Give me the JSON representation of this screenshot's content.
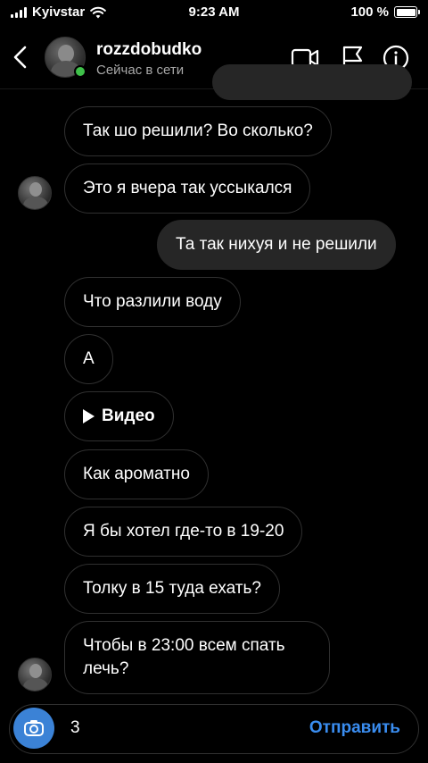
{
  "status_bar": {
    "carrier": "Kyivstar",
    "time": "9:23 AM",
    "battery": "100 %"
  },
  "header": {
    "username": "rozzdobudko",
    "status": "Сейчас в сети"
  },
  "messages": [
    {
      "text": "Так шо решили? Во сколько?",
      "direction": "in"
    },
    {
      "text": "Это я вчера так уссыкался",
      "direction": "in"
    },
    {
      "text": "Та так нихуя и не решили",
      "direction": "out"
    },
    {
      "text": "Что разлили воду",
      "direction": "in"
    },
    {
      "text": "А",
      "direction": "in"
    },
    {
      "text": "Видео",
      "direction": "in",
      "kind": "video"
    },
    {
      "text": "Как ароматно",
      "direction": "in"
    },
    {
      "text": "Я бы хотел где-то в 19-20",
      "direction": "in"
    },
    {
      "text": "Толку в 15 туда ехать?",
      "direction": "in"
    },
    {
      "text": "Чтобы в 23:00 всем спать лечь?",
      "direction": "in"
    }
  ],
  "composer": {
    "value": "3",
    "send_label": "Отправить"
  },
  "colors": {
    "background": "#000000",
    "outgoing_bubble": "#262626",
    "bubble_border": "#303030",
    "online": "#3fc14a",
    "accent": "#3a8df0"
  }
}
